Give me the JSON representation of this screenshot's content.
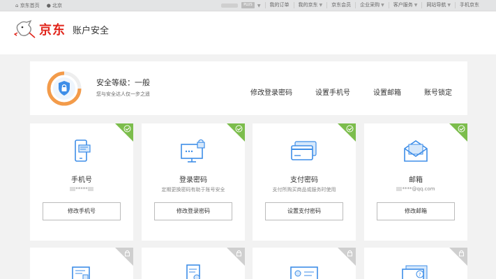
{
  "topbar": {
    "home_label": "京东首页",
    "location_label": "北京",
    "plus_label": "PLUS",
    "links": [
      "我的订单",
      "我的京东",
      "京东会员",
      "企业采购",
      "客户服务",
      "网站导航",
      "手机京东"
    ]
  },
  "header": {
    "logo_text": "京东",
    "page_title": "账户安全"
  },
  "summary": {
    "level_title": "安全等级：一般",
    "level_sub": "您与安全达人仅一步之遥",
    "links": [
      "修改登录密码",
      "设置手机号",
      "设置邮箱",
      "账号锁定"
    ]
  },
  "cards": [
    {
      "name": "手机号",
      "desc_masked": "*****",
      "button": "修改手机号",
      "status": "verified",
      "icon": "phone-icon"
    },
    {
      "name": "登录密码",
      "desc": "定期更换密码有助于账号安全",
      "button": "修改登录密码",
      "status": "verified",
      "icon": "monitor-lock-icon"
    },
    {
      "name": "支付密码",
      "desc": "支付所购买商品或服务时使用",
      "button": "设置支付密码",
      "status": "verified",
      "icon": "card-icon"
    },
    {
      "name": "邮箱",
      "desc_masked": "****@qq.com",
      "button": "修改邮箱",
      "status": "verified",
      "icon": "envelope-icon"
    }
  ],
  "colors": {
    "brand_red": "#e1251b",
    "accent_blue": "#3e8ee8",
    "verified_green": "#7cbd4c",
    "gauge_orange": "#f39b4a"
  }
}
